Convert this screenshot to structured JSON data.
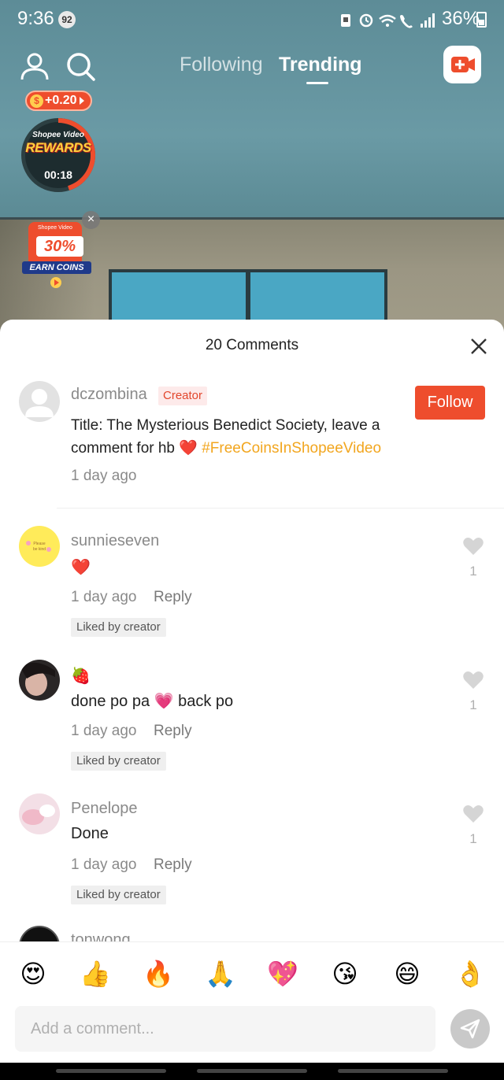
{
  "status_bar": {
    "time": "9:36",
    "notification_count": "92",
    "battery": "36%"
  },
  "top_nav": {
    "tabs": [
      {
        "label": "Following",
        "active": false
      },
      {
        "label": "Trending",
        "active": true
      }
    ]
  },
  "rewards": {
    "coin_bonus": "+0.20",
    "brand": "Shopee Video",
    "title": "REWARDS",
    "timer": "00:18",
    "promo_brand": "Shopee Video",
    "promo_discount": "30%",
    "promo_label": "EARN COINS"
  },
  "comments_sheet": {
    "title": "20 Comments",
    "creator_post": {
      "username": "dczombina",
      "badge": "Creator",
      "follow_label": "Follow",
      "caption_prefix": "Title: The Mysterious Benedict Society, leave a comment for hb",
      "caption_emoji": "❤️",
      "hashtag": "#FreeCoinsInShopeeVideo",
      "time": "1 day ago"
    },
    "comments": [
      {
        "user": "sunnieseven",
        "text": "❤️",
        "time": "1 day ago",
        "reply_label": "Reply",
        "liked_label": "Liked by creator",
        "likes": "1",
        "avatar_text": "Please be kind"
      },
      {
        "user": "🍓",
        "text": "done po pa 💗 back po",
        "time": "1 day ago",
        "reply_label": "Reply",
        "liked_label": "Liked by creator",
        "likes": "1"
      },
      {
        "user": "Penelope",
        "text": "Done",
        "time": "1 day ago",
        "reply_label": "Reply",
        "liked_label": "Liked by creator",
        "likes": "1"
      }
    ],
    "partial_comment_user": "tonwong"
  },
  "emoji_bar": [
    "😍",
    "👍",
    "🔥",
    "🙏",
    "💖",
    "😘",
    "😄",
    "👌"
  ],
  "composer": {
    "placeholder": "Add a comment...",
    "value": ""
  },
  "colors": {
    "accent": "#ee4d2d",
    "hashtag": "#f2a61f",
    "heart": "#e0243a"
  }
}
